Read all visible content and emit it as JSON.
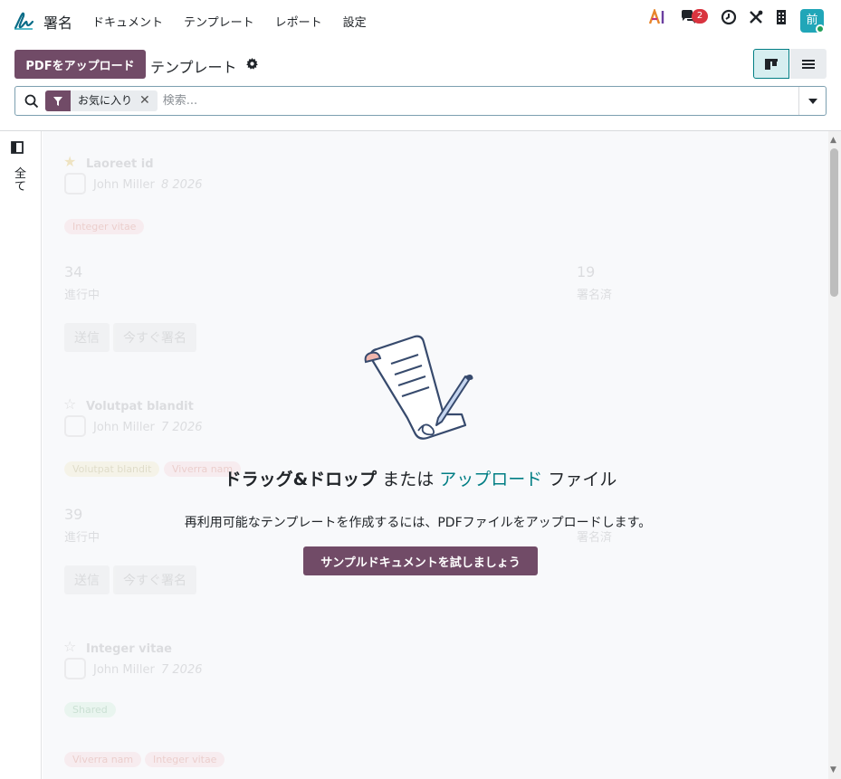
{
  "navbar": {
    "app_name": "署名",
    "menu": [
      "ドキュメント",
      "テンプレート",
      "レポート",
      "設定"
    ],
    "ai_label": "AI",
    "chat_count": "2",
    "avatar_initial": "前"
  },
  "control": {
    "upload_label": "PDFをアップロード",
    "title": "テンプレート"
  },
  "search": {
    "facet_label": "お気に入り",
    "placeholder": "検索..."
  },
  "sidebar": {
    "all_label": "全て"
  },
  "ghost_cards": [
    {
      "title": "Laoreet id",
      "owner": "John Miller",
      "date": "8 2026",
      "tags": [
        "Integer vitae"
      ],
      "in_progress": "34",
      "in_progress_label": "進行中",
      "signed": "19",
      "signed_label": "署名済",
      "send": "送信",
      "sign_now": "今すぐ署名"
    },
    {
      "title": "Volutpat blandit",
      "owner": "John Miller",
      "date": "7 2026",
      "tags": [
        "Volutpat blandit",
        "Viverra nam"
      ],
      "in_progress": "39",
      "in_progress_label": "進行中",
      "signed": "",
      "signed_label": "署名済",
      "send": "送信",
      "sign_now": "今すぐ署名"
    },
    {
      "title": "Integer vitae",
      "owner": "John Miller",
      "date": "7 2026",
      "tags": [
        "Shared",
        "Viverra nam",
        "Integer vitae"
      ]
    }
  ],
  "help": {
    "drag_text": "ドラッグ&ドロップ",
    "or_text": "または",
    "upload_link": "アップロード",
    "file_text": "ファイル",
    "description": "再利用可能なテンプレートを作成するには、PDFファイルをアップロードします。",
    "sample_button": "サンプルドキュメントを試しましょう"
  },
  "colors": {
    "brand": "#714b67",
    "link": "#017e84",
    "badge": "#d9343f",
    "avatar": "#21a6b8"
  },
  "icons": [
    "sign-logo-icon",
    "chat-icon",
    "clock-icon",
    "tools-icon",
    "building-icon",
    "gear-icon",
    "kanban-view-icon",
    "list-view-icon",
    "search-icon",
    "filter-icon",
    "close-icon",
    "caret-down-icon",
    "sidebar-toggle-icon"
  ]
}
